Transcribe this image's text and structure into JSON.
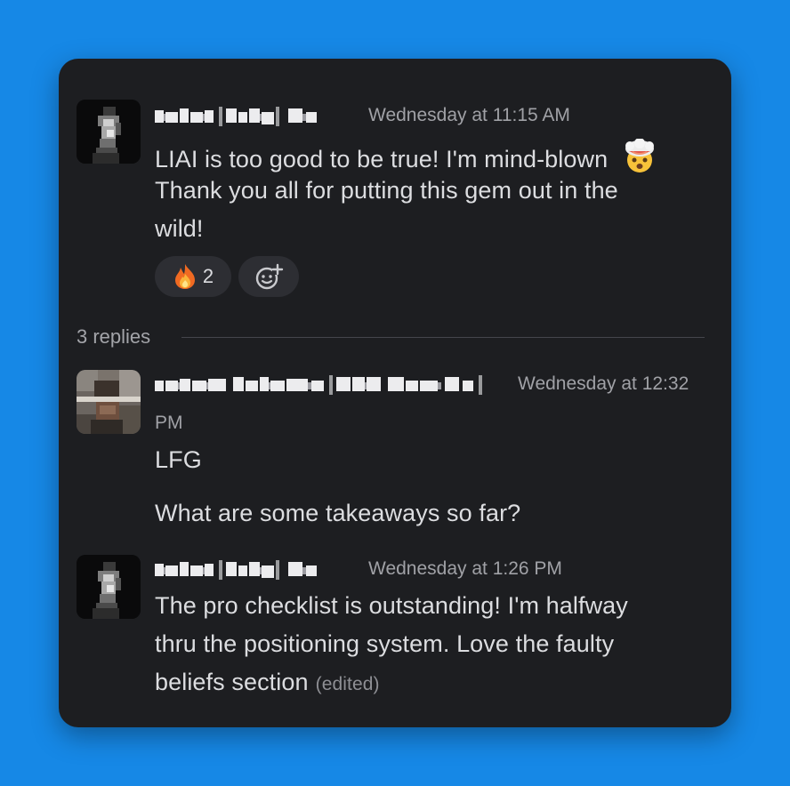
{
  "thread": {
    "parent": {
      "author_icon": "pixelated-name",
      "timestamp": "Wednesday at 11:15 AM",
      "lines": [
        "LIAI is too good to be true! I'm mind-blown",
        "Thank you all for putting this gem out in the",
        "wild!"
      ],
      "line_emoji": "exploding-head-icon",
      "reactions": [
        {
          "emoji": "fire-icon",
          "count": "2"
        }
      ],
      "add_reaction_icon": "add-reaction-icon"
    },
    "replies_label": "3 replies",
    "replies": [
      {
        "timestamp_line1": "Wednesday at 12:32",
        "timestamp_line2": "PM",
        "paragraphs": [
          "LFG",
          "What are some takeaways so far?"
        ]
      },
      {
        "timestamp": "Wednesday at 1:26 PM",
        "lines": [
          "The pro checklist is outstanding! I'm halfway",
          "thru the positioning system. Love the faulty",
          "beliefs section"
        ],
        "edited_label": "(edited)"
      }
    ]
  },
  "colors": {
    "background": "#1688e6",
    "card": "#1d1e21",
    "text": "#dcdde0",
    "muted": "#a0a1a6",
    "reaction_bg": "#2d2e33"
  }
}
